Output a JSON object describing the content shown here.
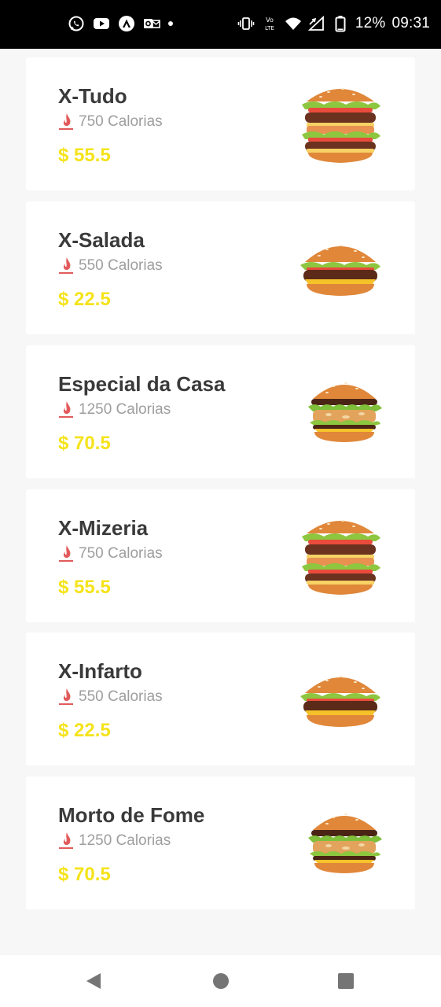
{
  "status_bar": {
    "battery": "12%",
    "time": "09:31",
    "left_icons": [
      "whatsapp-icon",
      "youtube-icon",
      "app-icon",
      "outlook-icon",
      "notification-dot"
    ],
    "right_icons": [
      "vibrate-icon",
      "volte-icon",
      "wifi-icon",
      "signal-icon",
      "battery-icon"
    ]
  },
  "menu": {
    "items": [
      {
        "name": "X-Tudo",
        "calories": "750 Calorias",
        "price": "$ 55.5",
        "image": "tall-burger"
      },
      {
        "name": "X-Salada",
        "calories": "550 Calorias",
        "price": "$ 22.5",
        "image": "cheeseburger"
      },
      {
        "name": "Especial da Casa",
        "calories": "1250 Calorias",
        "price": "$ 70.5",
        "image": "crispy-burger"
      },
      {
        "name": "X-Mizeria",
        "calories": "750 Calorias",
        "price": "$ 55.5",
        "image": "tall-burger"
      },
      {
        "name": "X-Infarto",
        "calories": "550 Calorias",
        "price": "$ 22.5",
        "image": "cheeseburger"
      },
      {
        "name": "Morto de Fome",
        "calories": "1250 Calorias",
        "price": "$ 70.5",
        "image": "crispy-burger"
      }
    ]
  },
  "colors": {
    "price": "#f5e31b",
    "flame": "#e25b5b",
    "name": "#3a3a3a",
    "calories": "#9e9e9e",
    "background": "#f7f7f7"
  },
  "nav_bar": {
    "buttons": [
      "back-icon",
      "home-icon",
      "recents-icon"
    ]
  }
}
